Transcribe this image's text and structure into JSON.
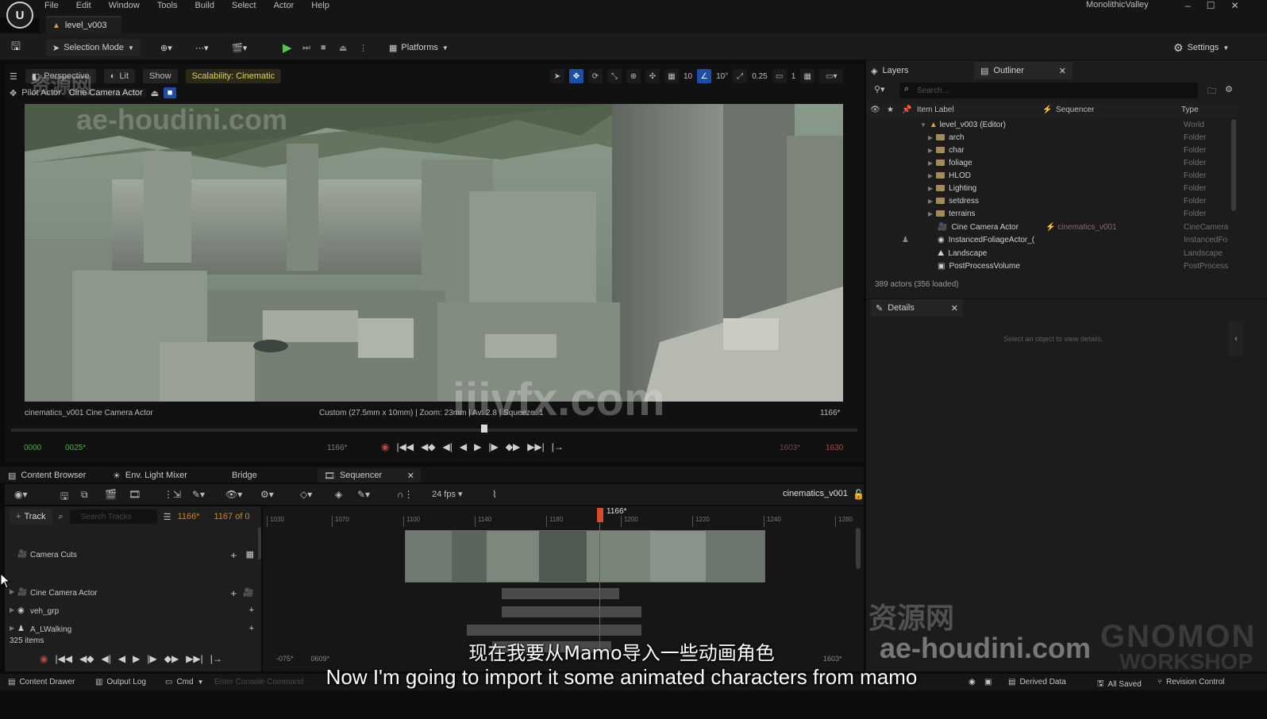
{
  "menubar": {
    "items": [
      "File",
      "Edit",
      "Window",
      "Tools",
      "Build",
      "Select",
      "Actor",
      "Help"
    ],
    "project": "MonolithicValley",
    "logo": "U"
  },
  "level_tab": "level_v003",
  "toolbar": {
    "selection_mode": "Selection Mode",
    "platforms": "Platforms",
    "settings": "Settings"
  },
  "viewport": {
    "perspective": "Perspective",
    "lit": "Lit",
    "show": "Show",
    "scalability": "Scalability: Cinematic",
    "pilot_label": "Pilot Actor",
    "pilot_actor": "Cine Camera Actor",
    "grid_snap": "10",
    "rot_snap": "10°",
    "scale_snap": "0.25",
    "cam_speed": "1",
    "camera_label": "cinematics_v001  Cine Camera Actor",
    "camera_info": "Custom (27.5mm x 10mm) | Zoom: 23mm | Av: 2.8 | Squeeze: 1",
    "frame_right": "1166*",
    "tc_start": "0000",
    "tc_in": "0025*",
    "tc_cur": "1166*",
    "tc_out": "1603*",
    "tc_end": "1630"
  },
  "outliner": {
    "tab_layers": "Layers",
    "tab_outliner": "Outliner",
    "search_placeholder": "Search...",
    "col_label": "Item Label",
    "col_sequencer": "Sequencer",
    "col_type": "Type",
    "root": {
      "label": "level_v003 (Editor)",
      "type": "World"
    },
    "folders": [
      {
        "label": "arch",
        "type": "Folder"
      },
      {
        "label": "char",
        "type": "Folder"
      },
      {
        "label": "foliage",
        "type": "Folder"
      },
      {
        "label": "HLOD",
        "type": "Folder"
      },
      {
        "label": "Lighting",
        "type": "Folder"
      },
      {
        "label": "setdress",
        "type": "Folder"
      },
      {
        "label": "terrains",
        "type": "Folder"
      }
    ],
    "actors": [
      {
        "label": "Cine Camera Actor",
        "seq": "cinematics_v001",
        "type": "CineCamera"
      },
      {
        "label": "InstancedFoliageActor_(",
        "seq": "",
        "type": "InstancedFo"
      },
      {
        "label": "Landscape",
        "seq": "",
        "type": "Landscape"
      },
      {
        "label": "PostProcessVolume",
        "seq": "",
        "type": "PostProcess"
      }
    ],
    "count": "389 actors (356 loaded)"
  },
  "details": {
    "tab": "Details",
    "empty": "Select an object to view details."
  },
  "bottom_tabs": {
    "content_browser": "Content Browser",
    "light_mixer": "Env. Light Mixer",
    "bridge": "Bridge",
    "sequencer": "Sequencer"
  },
  "sequencer": {
    "fps": "24 fps",
    "sequence_name": "cinematics_v001",
    "add_track": "Track",
    "search_placeholder": "Search Tracks",
    "current_frame": "1166*",
    "frame_of": "1167 of 0",
    "playhead": "1166*",
    "ruler": [
      "1030",
      "1070",
      "1100",
      "1140",
      "1180",
      "1200",
      "1220",
      "1240",
      "1280"
    ],
    "tracks": [
      {
        "label": "Camera Cuts"
      },
      {
        "label": "Cine Camera Actor"
      },
      {
        "label": "veh_grp"
      },
      {
        "label": "A_LWalking"
      }
    ],
    "item_count": "325 items",
    "tc_left": "-075*",
    "tc_left2": "0609*",
    "tc_right": "1603*"
  },
  "statusbar": {
    "content_drawer": "Content Drawer",
    "output_log": "Output Log",
    "cmd": "Cmd",
    "console_placeholder": "Enter Console Command",
    "derived_data": "Derived Data",
    "all_saved": "All Saved",
    "revision_control": "Revision Control"
  },
  "watermarks": {
    "cn1": "资源网",
    "url": "ae-houdini.com",
    "site": "iiivfx.com",
    "cn2": "资源网",
    "url2": "ae-houdini.com",
    "brand": "GNOMON",
    "brand2": "WORKSHOP"
  },
  "subtitles": {
    "cn": "现在我要从Mamo导入一些动画角色",
    "en": "Now I'm going to import it some animated characters from mamo"
  }
}
